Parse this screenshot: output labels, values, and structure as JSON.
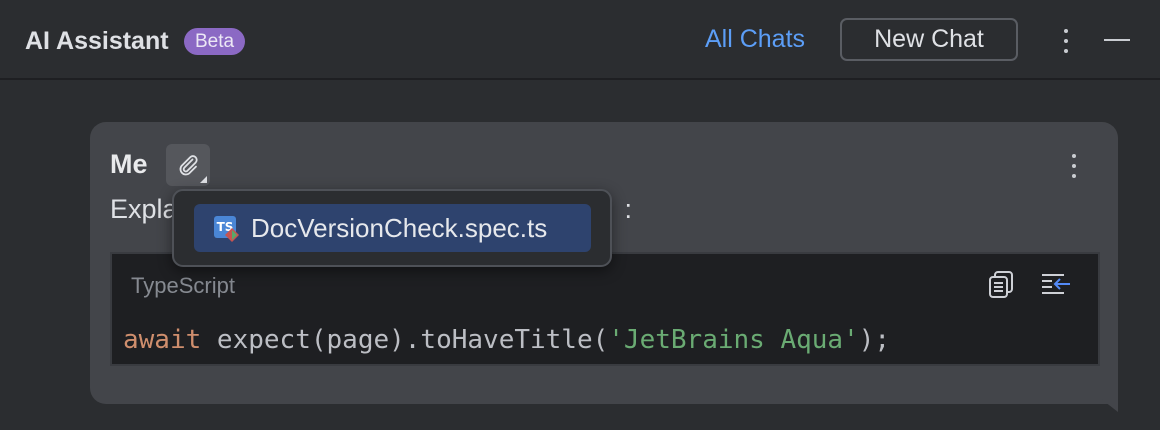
{
  "header": {
    "title": "AI Assistant",
    "badge": "Beta",
    "all_chats_label": "All Chats",
    "new_chat_label": "New Chat"
  },
  "message": {
    "sender": "Me",
    "text_visible": "Expla",
    "text_tail": ":",
    "code": {
      "language": "TypeScript",
      "tokens": {
        "keyword": "await",
        "call": " expect(page).toHaveTitle(",
        "string": "'JetBrains Aqua'",
        "end": ");"
      }
    }
  },
  "attachments_popup": {
    "files": [
      {
        "name": "DocVersionCheck.spec.ts",
        "icon": "typescript-file-icon",
        "icon_text": "TS"
      }
    ]
  },
  "colors": {
    "accent_link": "#5c9ef7",
    "beta_badge": "#8b69c4",
    "keyword": "#cf8e6d",
    "string": "#6aab73",
    "selection": "#2e436e"
  }
}
